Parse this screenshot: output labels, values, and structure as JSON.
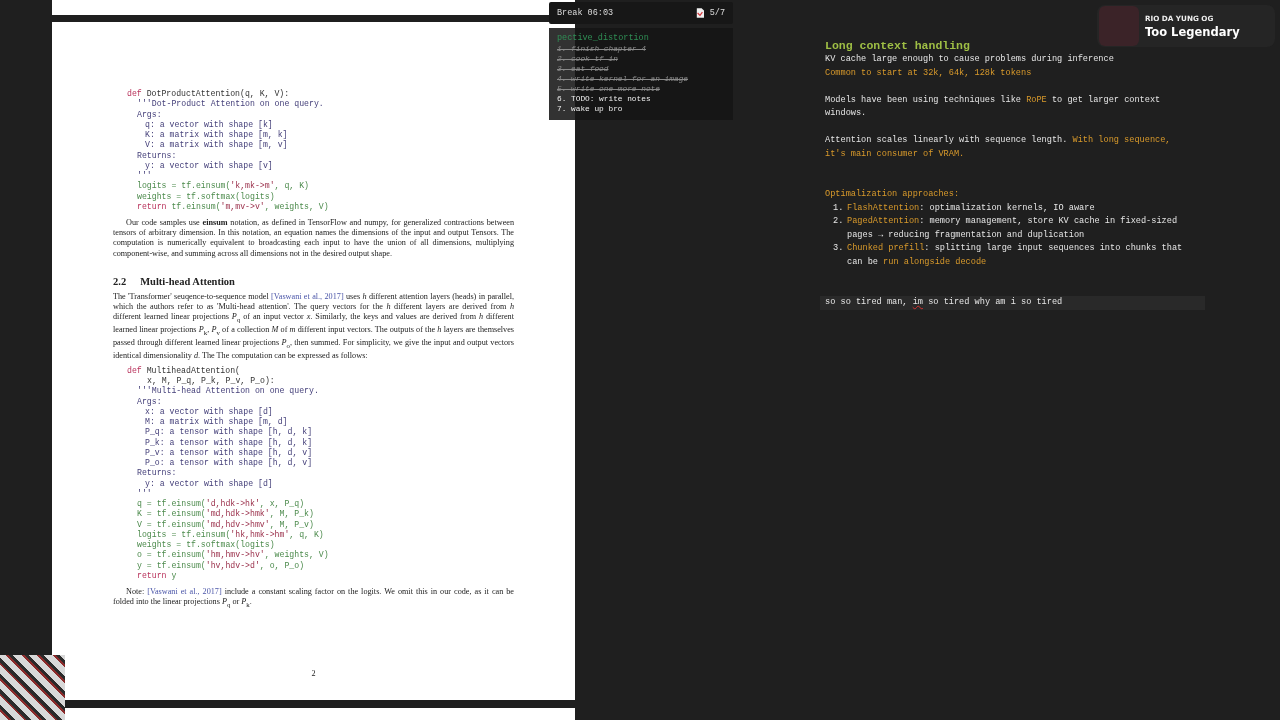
{
  "paper": {
    "code_blocks": [
      {
        "lines": [
          {
            "kind": "signature",
            "parts": [
              {
                "kind": "keyword",
                "text": "def "
              },
              {
                "kind": "name",
                "text": "DotProductAttention(q, K, V):"
              }
            ]
          },
          {
            "kind": "docstring",
            "parts": [
              {
                "kind": "doc",
                "text": "'''Dot-Product Attention on one query."
              }
            ]
          },
          {
            "kind": "docstring",
            "parts": [
              {
                "kind": "doc",
                "text": "Args:"
              }
            ]
          },
          {
            "kind": "arg",
            "parts": [
              {
                "kind": "doc",
                "text": "q: a vector with shape [k]"
              }
            ]
          },
          {
            "kind": "arg",
            "parts": [
              {
                "kind": "doc",
                "text": "K: a matrix with shape [m, k]"
              }
            ]
          },
          {
            "kind": "arg",
            "parts": [
              {
                "kind": "doc",
                "text": "V: a matrix with shape [m, v]"
              }
            ]
          },
          {
            "kind": "docstring",
            "parts": [
              {
                "kind": "doc",
                "text": "Returns:"
              }
            ]
          },
          {
            "kind": "arg",
            "parts": [
              {
                "kind": "doc",
                "text": "y: a vector with shape [v]"
              }
            ]
          },
          {
            "kind": "docstring",
            "parts": [
              {
                "kind": "doc",
                "text": "'''"
              }
            ]
          },
          {
            "kind": "statement",
            "parts": [
              {
                "kind": "var",
                "text": "logits = tf.einsum("
              },
              {
                "kind": "string",
                "text": "'k,mk->m'"
              },
              {
                "kind": "var",
                "text": ", q, K)"
              }
            ]
          },
          {
            "kind": "statement",
            "parts": [
              {
                "kind": "var",
                "text": "weights = tf.softmax(logits)"
              }
            ]
          },
          {
            "kind": "statement",
            "parts": [
              {
                "kind": "keyword",
                "text": "return "
              },
              {
                "kind": "var",
                "text": "tf.einsum("
              },
              {
                "kind": "string",
                "text": "'m,mv->v'"
              },
              {
                "kind": "var",
                "text": ", weights, V)"
              }
            ]
          }
        ]
      },
      {
        "lines": [
          {
            "kind": "signature",
            "parts": [
              {
                "kind": "keyword",
                "text": "def "
              },
              {
                "kind": "name",
                "text": "MultiheadAttention("
              }
            ]
          },
          {
            "kind": "continuation",
            "parts": [
              {
                "kind": "name",
                "text": "x, M, P_q, P_k, P_v, P_o):"
              }
            ]
          },
          {
            "kind": "docstring",
            "parts": [
              {
                "kind": "doc",
                "text": "'''Multi-head Attention on one query."
              }
            ]
          },
          {
            "kind": "docstring",
            "parts": [
              {
                "kind": "doc",
                "text": "Args:"
              }
            ]
          },
          {
            "kind": "arg",
            "parts": [
              {
                "kind": "doc",
                "text": "x: a vector with shape [d]"
              }
            ]
          },
          {
            "kind": "arg",
            "parts": [
              {
                "kind": "doc",
                "text": "M: a matrix with shape [m, d]"
              }
            ]
          },
          {
            "kind": "arg",
            "parts": [
              {
                "kind": "doc",
                "text": "P_q: a tensor with shape [h, d, k]"
              }
            ]
          },
          {
            "kind": "arg",
            "parts": [
              {
                "kind": "doc",
                "text": "P_k: a tensor with shape [h, d, k]"
              }
            ]
          },
          {
            "kind": "arg",
            "parts": [
              {
                "kind": "doc",
                "text": "P_v: a tensor with shape [h, d, v]"
              }
            ]
          },
          {
            "kind": "arg",
            "parts": [
              {
                "kind": "doc",
                "text": "P_o: a tensor with shape [h, d, v]"
              }
            ]
          },
          {
            "kind": "docstring",
            "parts": [
              {
                "kind": "doc",
                "text": "Returns:"
              }
            ]
          },
          {
            "kind": "arg",
            "parts": [
              {
                "kind": "doc",
                "text": "y: a vector with shape [d]"
              }
            ]
          },
          {
            "kind": "docstring",
            "parts": [
              {
                "kind": "doc",
                "text": "'''"
              }
            ]
          },
          {
            "kind": "statement",
            "parts": [
              {
                "kind": "var",
                "text": "q = tf.einsum("
              },
              {
                "kind": "string",
                "text": "'d,hdk->hk'"
              },
              {
                "kind": "var",
                "text": ", x, P_q)"
              }
            ]
          },
          {
            "kind": "statement",
            "parts": [
              {
                "kind": "var",
                "text": "K = tf.einsum("
              },
              {
                "kind": "string",
                "text": "'md,hdk->hmk'"
              },
              {
                "kind": "var",
                "text": ", M, P_k)"
              }
            ]
          },
          {
            "kind": "statement",
            "parts": [
              {
                "kind": "var",
                "text": "V = tf.einsum("
              },
              {
                "kind": "string",
                "text": "'md,hdv->hmv'"
              },
              {
                "kind": "var",
                "text": ", M, P_v)"
              }
            ]
          },
          {
            "kind": "statement",
            "parts": [
              {
                "kind": "var",
                "text": "logits = tf.einsum("
              },
              {
                "kind": "string",
                "text": "'hk,hmk->hm'"
              },
              {
                "kind": "var",
                "text": ", q, K)"
              }
            ]
          },
          {
            "kind": "statement",
            "parts": [
              {
                "kind": "var",
                "text": "weights = tf.softmax(logits)"
              }
            ]
          },
          {
            "kind": "statement",
            "parts": [
              {
                "kind": "var",
                "text": "o = tf.einsum("
              },
              {
                "kind": "string",
                "text": "'hm,hmv->hv'"
              },
              {
                "kind": "var",
                "text": ", weights, V)"
              }
            ]
          },
          {
            "kind": "statement",
            "parts": [
              {
                "kind": "var",
                "text": "y = tf.einsum("
              },
              {
                "kind": "string",
                "text": "'hv,hdv->d'"
              },
              {
                "kind": "var",
                "text": ", o, P_o)"
              }
            ]
          },
          {
            "kind": "statement",
            "parts": [
              {
                "kind": "keyword",
                "text": "return "
              },
              {
                "kind": "var",
                "text": "y"
              }
            ]
          }
        ]
      }
    ],
    "paragraph_1": [
      {
        "kind": "text",
        "text": "Our code samples use **einsum** notation, as defined in TensorFlow and numpy, for generalized contractions between tensors of arbitrary dimension. In this notation, an equation names the dimensions of the input and output Tensors. The computation is numerically equivalent to broadcasting each input to have the union of all dimensions, multiplying component-wise, and summing across all dimensions not in the desired output shape."
      }
    ],
    "section_number": "2.2",
    "section_title": "Multi-head Attention",
    "paragraph_2": [
      {
        "kind": "text",
        "text": "The 'Transformer' seuqence-to-sequence model "
      },
      {
        "kind": "link",
        "text": "[Vaswani et al., 2017]"
      },
      {
        "kind": "text",
        "text": " uses *h* different attention layers (heads) in parallel, which the authors refer to as 'Multi-head attention'. The query vectors for the *h* different layers are derived from *h* different learned linear projections *P*$_{q}$ of an input vector *x*. Similarly, the keys and values are derived from *h* different learned linear projections *P*$_{k}$, *P*$_{v}$ of a collection *M* of *m* different input vectors. The outputs of the *h* layers are themselves passed through different learned linear projections *P*$_{o}$, then summed. For simplicity, we give the input and output vectors identical dimensionality *d*. The The computation can be expressed as follows:"
      }
    ],
    "note": [
      {
        "kind": "text",
        "text": "Note: "
      },
      {
        "kind": "link",
        "text": "[Vaswani et al., 2017]"
      },
      {
        "kind": "text",
        "text": " include a constant scaling factor on the logits. We omit this in our code, as it can be folded into the linear projections *P*$_{q}$ or *P*$_{k}$."
      }
    ],
    "page_number": "2"
  },
  "break_timer": {
    "label": "Break 06:03",
    "counter": "5/7"
  },
  "todo": {
    "title": "pective_distortion",
    "items": [
      {
        "text": "1. finish chapter 4",
        "done": true
      },
      {
        "text": "2. cook tf in",
        "done": true
      },
      {
        "text": "3. eat food",
        "done": true
      },
      {
        "text": "4. write kernel for an image",
        "done": true
      },
      {
        "text": "5. write one more note",
        "done": true
      },
      {
        "text": "6. TODO: write notes",
        "done": false
      },
      {
        "text": "7. wake up bro",
        "done": false
      }
    ]
  },
  "notes": {
    "heading": "Long context handling",
    "blocks": [
      {
        "kind": "text",
        "lines": [
          [
            {
              "kind": "plain",
              "text": "KV cache large enough to cause problems during inference"
            }
          ],
          [
            {
              "kind": "accent",
              "text": "Common to start at 32k, 64k, 128k tokens"
            }
          ]
        ]
      },
      {
        "kind": "text",
        "lines": [
          [
            {
              "kind": "plain",
              "text": "Models have been using techniques like "
            },
            {
              "kind": "accent",
              "text": "RoPE"
            },
            {
              "kind": "plain",
              "text": " to get larger context windows."
            }
          ]
        ]
      },
      {
        "kind": "text",
        "lines": [
          [
            {
              "kind": "plain",
              "text": "Attention scales linearly with sequence length. "
            },
            {
              "kind": "accent",
              "text": "With long sequence, it's main consumer of VRAM."
            }
          ]
        ]
      },
      {
        "kind": "list",
        "title": [
          {
            "kind": "accent",
            "text": "Optimalization approaches:"
          }
        ],
        "items": [
          {
            "number": "1.",
            "parts": [
              {
                "kind": "accent",
                "text": "FlashAttention"
              },
              {
                "kind": "plain",
                "text": ": optimalization kernels, IO aware"
              }
            ]
          },
          {
            "number": "2.",
            "parts": [
              {
                "kind": "accent",
                "text": "PagedAttention"
              },
              {
                "kind": "plain",
                "text": ": memory management, store KV cache in fixed-sized pages → reducing fragmentation and duplication"
              }
            ]
          },
          {
            "number": "3.",
            "parts": [
              {
                "kind": "accent",
                "text": "Chunked prefill"
              },
              {
                "kind": "plain",
                "text": ": splitting large input sequences into chunks that can be "
              },
              {
                "kind": "accent",
                "text": "run alongside decode"
              }
            ]
          }
        ]
      },
      {
        "kind": "current",
        "lines": [
          [
            {
              "kind": "plain",
              "text": "so so tired man, "
            },
            {
              "kind": "misspelled",
              "text": "im"
            },
            {
              "kind": "plain",
              "text": " so tired why am i so tired"
            }
          ]
        ]
      }
    ]
  },
  "now_playing": {
    "artist": "RIO DA YUNG OG",
    "title": "Too Legendary"
  }
}
